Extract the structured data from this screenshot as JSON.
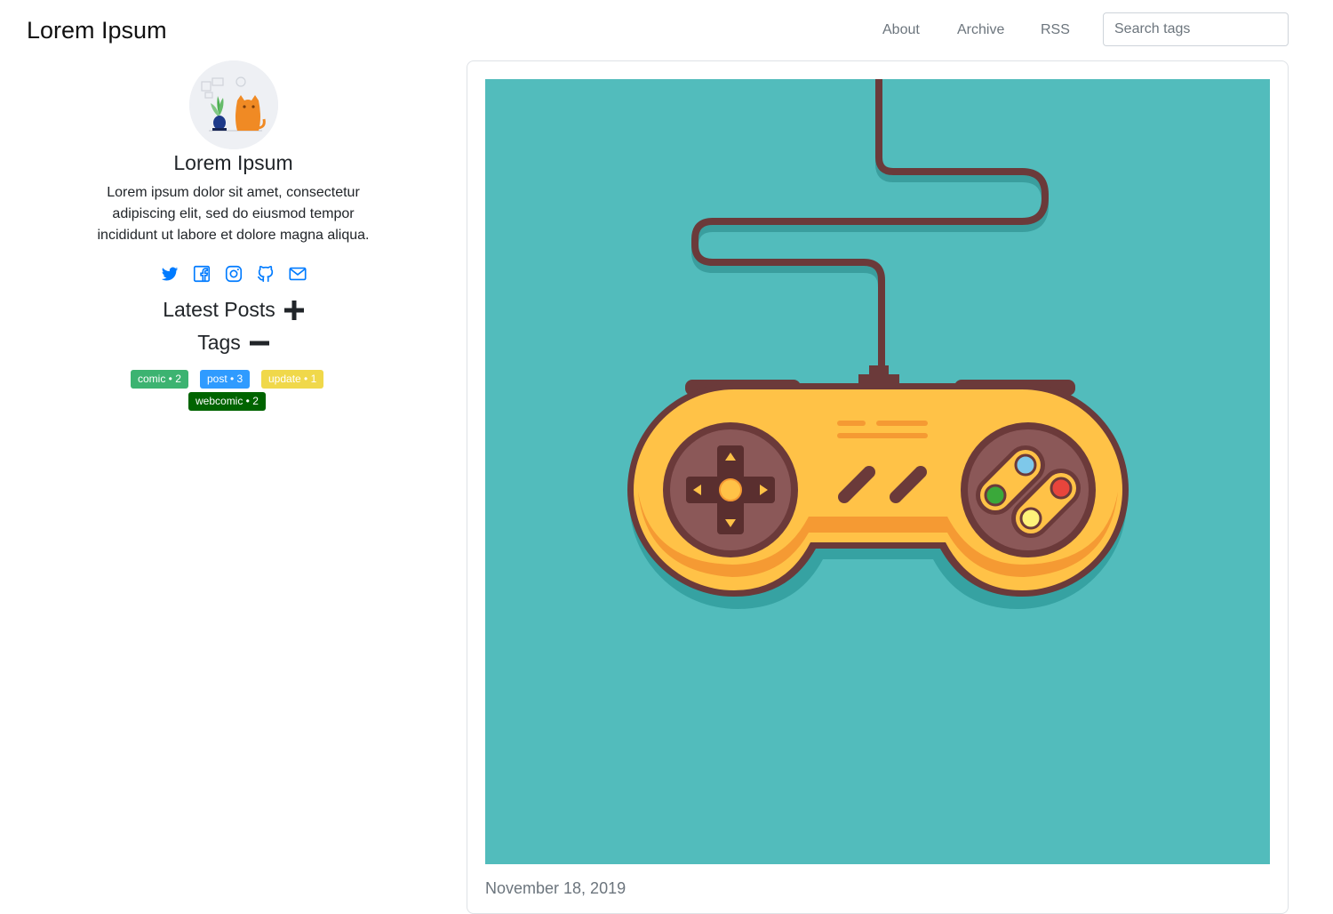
{
  "header": {
    "brand": "Lorem Ipsum",
    "nav": [
      {
        "label": "About"
      },
      {
        "label": "Archive"
      },
      {
        "label": "RSS"
      }
    ],
    "search_placeholder": "Search tags"
  },
  "profile": {
    "name": "Lorem Ipsum",
    "bio": "Lorem ipsum dolor sit amet, consectetur adipiscing elit, sed do eiusmod tempor incididunt ut labore et dolore magna aliqua.",
    "social_icons": [
      "twitter-icon",
      "facebook-icon",
      "instagram-icon",
      "github-icon",
      "mail-icon"
    ],
    "icon_color": "#007bff"
  },
  "sections": {
    "latest_posts": {
      "label": "Latest Posts",
      "state": "collapsed"
    },
    "tags": {
      "label": "Tags",
      "state": "expanded"
    }
  },
  "tags": [
    {
      "label": "comic • 2",
      "color": "#3cb371"
    },
    {
      "label": "post • 3",
      "color": "#2f9bff"
    },
    {
      "label": "update • 1",
      "color": "#f0d84a"
    },
    {
      "label": "webcomic • 2",
      "color": "#006400"
    }
  ],
  "post": {
    "image_background": "#52bcbc",
    "date": "November 18, 2019"
  }
}
